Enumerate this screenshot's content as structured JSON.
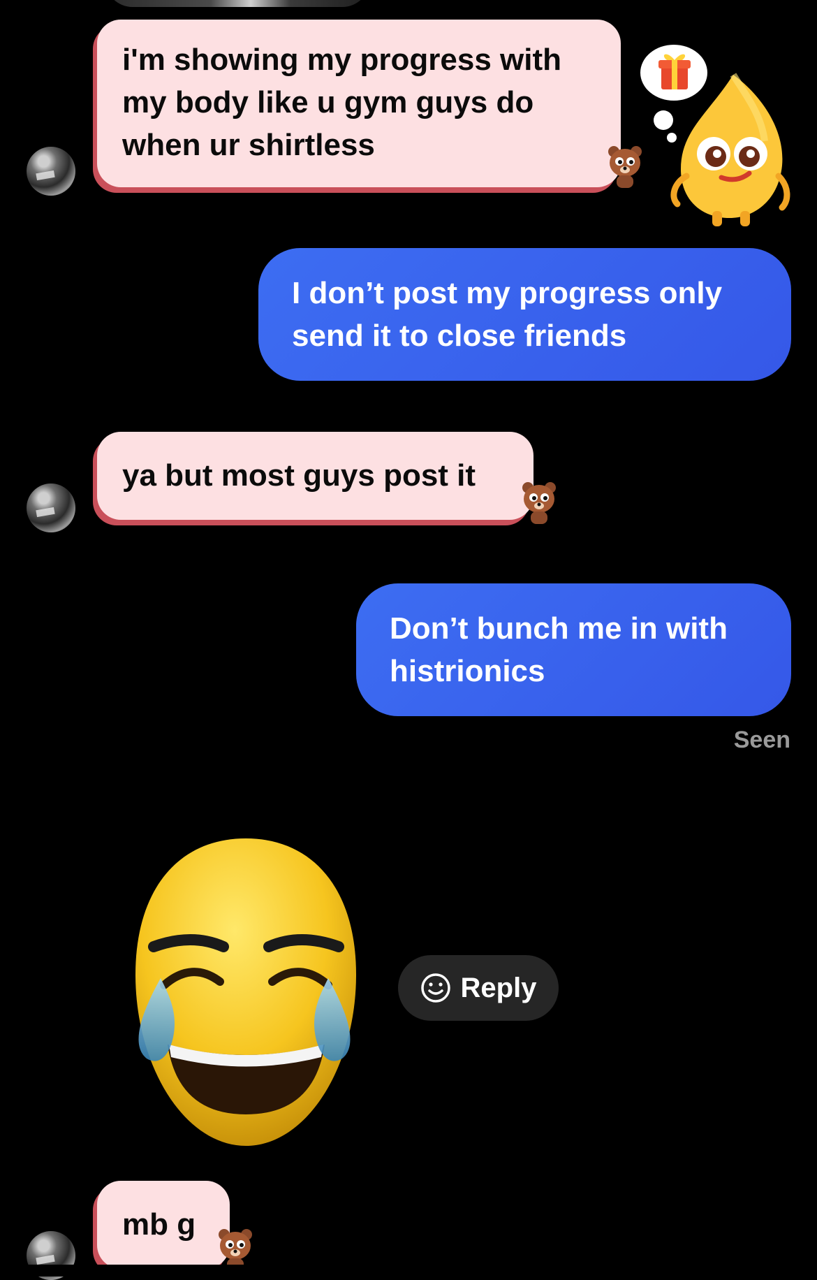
{
  "messages": [
    {
      "id": "m1",
      "direction": "incoming",
      "lines": [
        "i'm showing my progress with",
        "my body like u gym guys do",
        "when ur shirtless"
      ]
    },
    {
      "id": "m2",
      "direction": "outgoing",
      "lines": [
        "I don’t post my progress only",
        "send it to close friends"
      ]
    },
    {
      "id": "m3",
      "direction": "incoming",
      "lines": [
        "ya but most guys post it"
      ]
    },
    {
      "id": "m4",
      "direction": "outgoing",
      "lines": [
        "Don’t bunch me in with",
        "histrionics"
      ]
    },
    {
      "id": "m5",
      "direction": "incoming",
      "lines": [
        "mb g"
      ]
    }
  ],
  "status": {
    "seen": "Seen"
  },
  "reaction": {
    "emoji": "face-with-tears-of-joy",
    "reply_label": "Reply"
  },
  "icons": {
    "avatar": "avatar-photo",
    "bubble_sticker": "bear-sticker",
    "mascot": "yellow-mascot-with-gift-thought",
    "reply": "smiley-icon"
  },
  "colors": {
    "background": "#000000",
    "incoming_bubble": "#fde0e2",
    "incoming_accent": "#c9505a",
    "outgoing_bubble": "#3d6df2",
    "reply_button": "#262626",
    "seen_text": "#9a9a9a"
  }
}
